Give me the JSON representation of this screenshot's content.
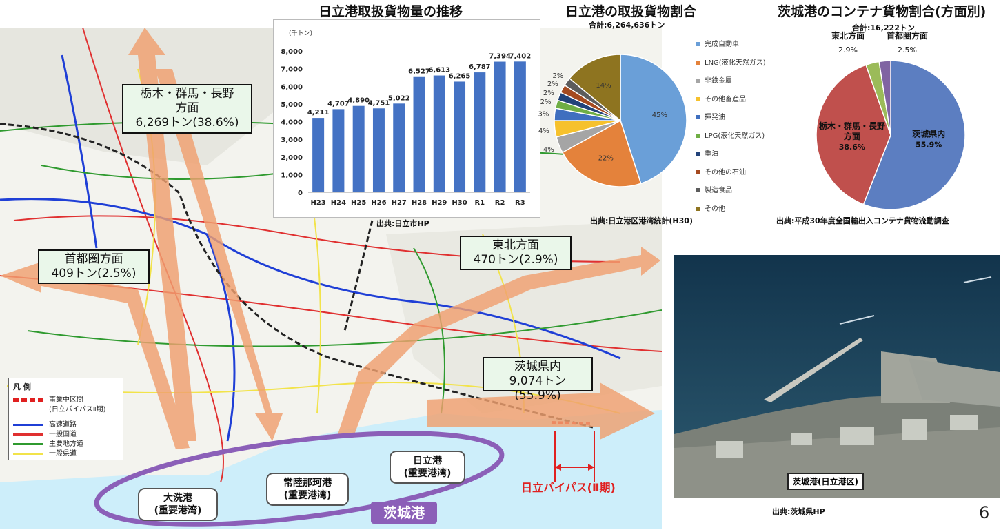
{
  "map": {
    "directions": [
      {
        "name": "栃木・群馬・長野方面",
        "line1": "栃木・群馬・長野",
        "line2": "方面",
        "value": "6,269トン(38.6%)"
      },
      {
        "name": "首都圏方面",
        "line1": "首都圏方面",
        "value": "409トン(2.5%)"
      },
      {
        "name": "東北方面",
        "line1": "東北方面",
        "value": "470トン(2.9%)"
      },
      {
        "name": "茨城県内",
        "line1": "茨城県内",
        "value": "9,074トン(55.9%)"
      }
    ],
    "ports": [
      {
        "name": "大洗港",
        "type": "(重要港湾)"
      },
      {
        "name": "常陸那珂港",
        "type": "(重要港湾)"
      },
      {
        "name": "日立港",
        "type": "(重要港湾)"
      }
    ],
    "group_label": "茨城港",
    "bypass_label": "日立バイパス(Ⅱ期)",
    "legend": {
      "title": "凡 例",
      "items": [
        {
          "label": "事業中区間",
          "sub": "(日立バイパスⅡ期)",
          "color": "#e02020"
        },
        {
          "label": "高速道路",
          "color": "#1f3fd6"
        },
        {
          "label": "一般国道",
          "color": "#e03030"
        },
        {
          "label": "主要地方道",
          "color": "#2f9a2f"
        },
        {
          "label": "一般県道",
          "color": "#f2e34a"
        }
      ]
    }
  },
  "bar_chart_title": "日立港取扱貨物量の推移",
  "bar_source": "出典:日立市HP",
  "pie1_title": "日立港の取扱貨物割合",
  "pie1_total": "合計:6,264,636トン",
  "pie1_source": "出典:日立港区港湾統計(H30)",
  "pie2_title": "茨城港のコンテナ貨物割合(方面別)",
  "pie2_total": "合計:16,222トン",
  "pie2_source": "出典:平成30年度全国輸出入コンテナ貨物流動調査",
  "photo_caption": "茨城港(日立港区)",
  "photo_source": "出典:茨城県HP",
  "page_number": "6",
  "chart_data": [
    {
      "type": "bar",
      "title": "日立港取扱貨物量の推移",
      "ylabel": "(千トン)",
      "categories": [
        "H23",
        "H24",
        "H25",
        "H26",
        "H27",
        "H28",
        "H29",
        "H30",
        "R1",
        "R2",
        "R3"
      ],
      "values": [
        4211,
        4707,
        4890,
        4751,
        5022,
        6527,
        6613,
        6265,
        6787,
        7394,
        7402
      ],
      "value_labels": [
        "4,211",
        "4,707",
        "4,890",
        "4,751",
        "5,022",
        "6,527",
        "6,613",
        "6,265",
        "6,787",
        "7,394",
        "7,402"
      ],
      "ylim": [
        0,
        8000
      ],
      "yticks": [
        "0",
        "1,000",
        "2,000",
        "3,000",
        "4,000",
        "5,000",
        "6,000",
        "7,000",
        "8,000"
      ],
      "color": "#4472c4",
      "grid": false
    },
    {
      "type": "pie",
      "title": "日立港の取扱貨物割合",
      "legend_position": "right",
      "slices": [
        {
          "label": "完成自動車",
          "value": 45,
          "text": "45%",
          "color": "#6a9fd8"
        },
        {
          "label": "LNG(液化天然ガス)",
          "value": 22,
          "text": "22%",
          "color": "#e4823b"
        },
        {
          "label": "非鉄金属",
          "value": 4,
          "text": "4%",
          "color": "#a5a5a5"
        },
        {
          "label": "その他畜産品",
          "value": 4,
          "text": "4%",
          "color": "#f6c12c"
        },
        {
          "label": "揮発油",
          "value": 3,
          "text": "3%",
          "color": "#3f6fbf"
        },
        {
          "label": "LPG(液化天然ガス)",
          "value": 2,
          "text": "2%",
          "color": "#6fae45"
        },
        {
          "label": "重油",
          "value": 2,
          "text": "2%",
          "color": "#22437a"
        },
        {
          "label": "その他の石油",
          "value": 2,
          "text": "2%",
          "color": "#a54a1f"
        },
        {
          "label": "製造食品",
          "value": 2,
          "text": "2%",
          "color": "#5c5c5c"
        },
        {
          "label": "その他",
          "value": 14,
          "text": "14%",
          "color": "#8e7420"
        }
      ]
    },
    {
      "type": "pie",
      "title": "茨城港のコンテナ貨物割合(方面別)",
      "slices": [
        {
          "label": "茨城県内",
          "value": 55.9,
          "text": "55.9%",
          "color": "#5c7ec1"
        },
        {
          "label": "栃木・群馬・長野方面",
          "value": 38.6,
          "text": "38.6%",
          "color": "#c0504d"
        },
        {
          "label": "東北方面",
          "value": 2.9,
          "text": "2.9%",
          "color": "#9bbb59"
        },
        {
          "label": "首都圏方面",
          "value": 2.5,
          "text": "2.5%",
          "color": "#8064a2"
        }
      ]
    }
  ]
}
